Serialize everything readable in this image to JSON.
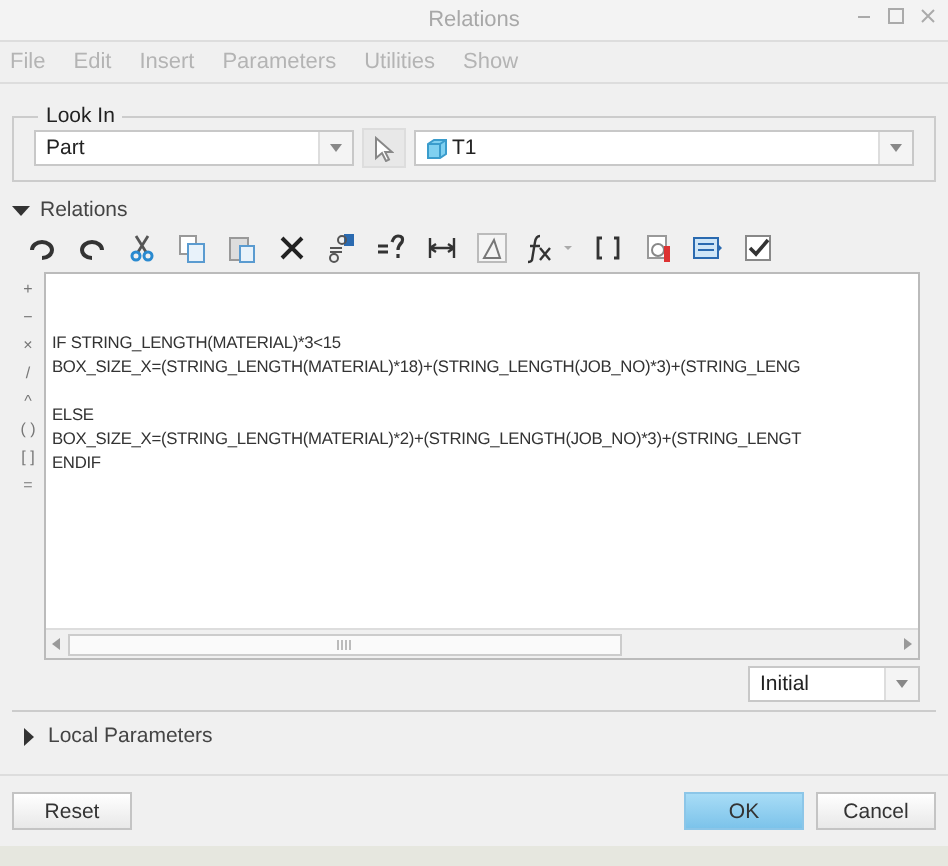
{
  "window": {
    "title": "Relations"
  },
  "menu": [
    {
      "label": "File",
      "disabled": true
    },
    {
      "label": "Edit",
      "disabled": true
    },
    {
      "label": "Insert",
      "disabled": true
    },
    {
      "label": "Parameters",
      "disabled": true
    },
    {
      "label": "Utilities",
      "disabled": true
    },
    {
      "label": "Show",
      "disabled": true
    }
  ],
  "look_in": {
    "title": "Look In",
    "type": "Part",
    "object": "T1"
  },
  "relations": {
    "title": "Relations",
    "expanded": true,
    "operators": [
      "+",
      "−",
      "×",
      "/",
      "^",
      "( )",
      "[ ]",
      "="
    ],
    "lines": [
      {
        "text": "IF STRING_LENGTH(MATERIAL)*3<15",
        "blank_before": false
      },
      {
        "text": "BOX_SIZE_X=(STRING_LENGTH(MATERIAL)*18)+(STRING_LENGTH(JOB_NO)*3)+(STRING_LENG",
        "blank_before": false
      },
      {
        "text": "ELSE",
        "blank_before": true
      },
      {
        "text": "BOX_SIZE_X=(STRING_LENGTH(MATERIAL)*2)+(STRING_LENGTH(JOB_NO)*3)+(STRING_LENGT",
        "blank_before": false
      },
      {
        "text": "ENDIF",
        "blank_before": false
      }
    ],
    "mode": "Initial"
  },
  "local_parameters": {
    "title": "Local Parameters",
    "expanded": false
  },
  "buttons": [
    {
      "label": "Reset",
      "kind": "plain"
    },
    {
      "label": "OK",
      "kind": "primary"
    },
    {
      "label": "Cancel",
      "kind": "plain"
    }
  ]
}
